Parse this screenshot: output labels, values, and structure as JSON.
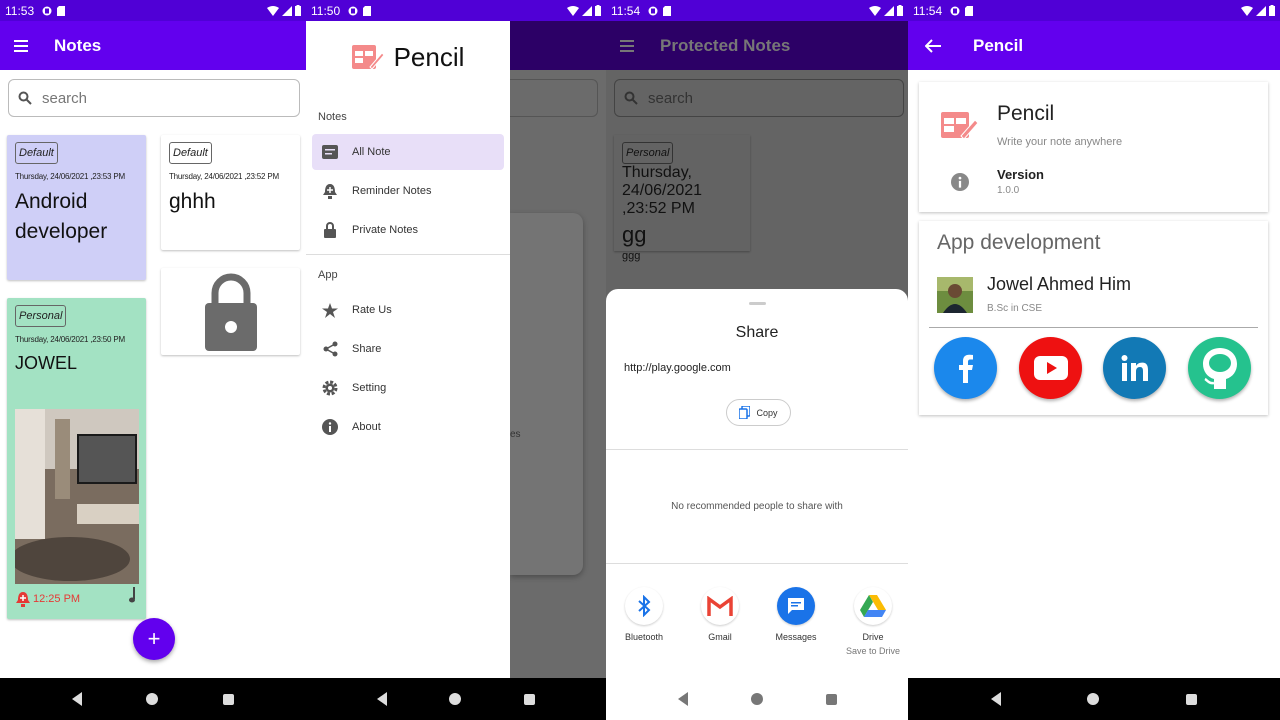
{
  "screen1": {
    "status_time": "11:53",
    "title": "Notes",
    "search_placeholder": "search",
    "cards": [
      {
        "tag": "Default",
        "date": "Thursday, 24/06/2021 ,23:53 PM",
        "title": "Android developer"
      },
      {
        "tag": "Default",
        "date": "Thursday, 24/06/2021 ,23:52 PM",
        "title": "ghhh"
      },
      {
        "tag": "Personal",
        "date": "Thursday, 24/06/2021 ,23:50 PM",
        "title": "JOWEL",
        "reminder": "12:25 PM"
      }
    ],
    "fab_label": "+"
  },
  "screen2": {
    "status_time": "11:50",
    "app_name": "Pencil",
    "section_notes": "Notes",
    "items_notes": [
      "All Note",
      "Reminder Notes",
      "Private Notes"
    ],
    "section_app": "App",
    "items_app": [
      "Rate Us",
      "Share",
      "Setting",
      "About"
    ],
    "behind_text": "es"
  },
  "screen3": {
    "status_time": "11:54",
    "title": "Protected Notes",
    "search_placeholder": "search",
    "card": {
      "tag": "Personal",
      "date": "Thursday, 24/06/2021 ,23:52 PM",
      "title": "gg",
      "body": "ggg"
    },
    "share_title": "Share",
    "share_url": "http://play.google.com",
    "copy_label": "Copy",
    "no_people": "No recommended people to share with",
    "apps": [
      {
        "name": "Bluetooth",
        "sub": ""
      },
      {
        "name": "Gmail",
        "sub": ""
      },
      {
        "name": "Messages",
        "sub": ""
      },
      {
        "name": "Drive",
        "sub": "Save to Drive"
      }
    ]
  },
  "screen4": {
    "status_time": "11:54",
    "title": "Pencil",
    "app_name": "Pencil",
    "tagline": "Write your note anywhere",
    "version_label": "Version",
    "version_value": "1.0.0",
    "dev_section": "App development",
    "dev_name": "Jowel Ahmed Him",
    "dev_degree": "B.Sc in CSE"
  },
  "colors": {
    "primary": "#6200ee",
    "status": "#5000d6",
    "note_purple": "#cfcff7",
    "note_green": "#a3e2c3",
    "reminder": "#e53935",
    "logo": "#f48a8a"
  }
}
